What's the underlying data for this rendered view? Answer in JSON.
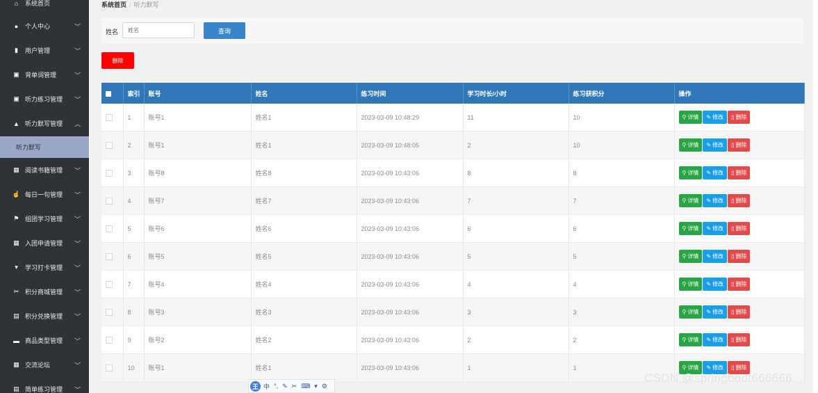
{
  "sidebar": {
    "items": [
      {
        "label": "系统首页",
        "icon": "home-icon",
        "glyph": "⌂",
        "chevron": false
      },
      {
        "label": "个人中心",
        "icon": "user-icon",
        "glyph": "●",
        "chevron": true
      },
      {
        "label": "用户管理",
        "icon": "bar-chart-icon",
        "glyph": "▮",
        "chevron": true
      },
      {
        "label": "背单词管理",
        "icon": "clipboard-icon",
        "glyph": "▣",
        "chevron": true
      },
      {
        "label": "听力练习管理",
        "icon": "checklist-icon",
        "glyph": "▣",
        "chevron": true
      },
      {
        "label": "听力默写管理",
        "icon": "bank-icon",
        "glyph": "▲",
        "chevron": true,
        "expanded": true
      },
      {
        "label": "阅读书籍管理",
        "icon": "grid-icon",
        "glyph": "▦",
        "chevron": true
      },
      {
        "label": "每日一句管理",
        "icon": "hand-pointer-icon",
        "glyph": "☝",
        "chevron": true
      },
      {
        "label": "组团学习管理",
        "icon": "flag-icon",
        "glyph": "⚑",
        "chevron": true
      },
      {
        "label": "入团申请管理",
        "icon": "grid-icon",
        "glyph": "▦",
        "chevron": true
      },
      {
        "label": "学习打卡管理",
        "icon": "trophy-icon",
        "glyph": "▾",
        "chevron": true
      },
      {
        "label": "积分商城管理",
        "icon": "ticket-icon",
        "glyph": "✂",
        "chevron": true
      },
      {
        "label": "积分兑换管理",
        "icon": "document-icon",
        "glyph": "▤",
        "chevron": true
      },
      {
        "label": "商品类型管理",
        "icon": "monitor-icon",
        "glyph": "▬",
        "chevron": true
      },
      {
        "label": "交流论坛",
        "icon": "grid-icon",
        "glyph": "▦",
        "chevron": true
      },
      {
        "label": "简单练习管理",
        "icon": "list-icon",
        "glyph": "▤",
        "chevron": true
      }
    ],
    "sub_item": {
      "label": "听力默写"
    }
  },
  "breadcrumb": {
    "home": "系统首页",
    "separator": "/",
    "current": "听力默写"
  },
  "search": {
    "label": "姓名",
    "placeholder": "姓名",
    "value": "",
    "button": "查询"
  },
  "toolbar": {
    "delete_label": "删除"
  },
  "table": {
    "headers": [
      "索引",
      "账号",
      "姓名",
      "练习时间",
      "学习时长/小时",
      "练习获积分",
      "操作"
    ],
    "action_labels": {
      "detail": "详情",
      "edit": "修改",
      "delete": "删除"
    },
    "rows": [
      {
        "index": "1",
        "account": "账号1",
        "name": "姓名1",
        "time": "2023-03-09 10:48:29",
        "duration": "11",
        "points": "10"
      },
      {
        "index": "2",
        "account": "账号1",
        "name": "姓名1",
        "time": "2023-03-09 10:48:05",
        "duration": "2",
        "points": "10"
      },
      {
        "index": "3",
        "account": "账号8",
        "name": "姓名8",
        "time": "2023-03-09 10:43:06",
        "duration": "8",
        "points": "8"
      },
      {
        "index": "4",
        "account": "账号7",
        "name": "姓名7",
        "time": "2023-03-09 10:43:06",
        "duration": "7",
        "points": "7"
      },
      {
        "index": "5",
        "account": "账号6",
        "name": "姓名6",
        "time": "2023-03-09 10:43:06",
        "duration": "6",
        "points": "6"
      },
      {
        "index": "6",
        "account": "账号5",
        "name": "姓名5",
        "time": "2023-03-09 10:43:06",
        "duration": "5",
        "points": "5"
      },
      {
        "index": "7",
        "account": "账号4",
        "name": "姓名4",
        "time": "2023-03-09 10:43:06",
        "duration": "4",
        "points": "4"
      },
      {
        "index": "8",
        "account": "账号3",
        "name": "姓名3",
        "time": "2023-03-09 10:43:06",
        "duration": "3",
        "points": "3"
      },
      {
        "index": "9",
        "account": "账号2",
        "name": "姓名2",
        "time": "2023-03-09 10:43:06",
        "duration": "2",
        "points": "2"
      },
      {
        "index": "10",
        "account": "账号1",
        "name": "姓名1",
        "time": "2023-03-09 10:43:06",
        "duration": "1",
        "points": "1"
      }
    ]
  },
  "ime_toolbar": {
    "logo": "王",
    "mode": "中"
  },
  "watermark": "CSDN @springboot666666",
  "colors": {
    "sidebar_bg": "#2f3337",
    "header_blue": "#2f77b6",
    "search_blue": "#3a85c9",
    "delete_red": "#ff0000",
    "detail_green": "#28a645",
    "edit_blue": "#1a9ee8",
    "remove_red": "#e14b4b"
  }
}
